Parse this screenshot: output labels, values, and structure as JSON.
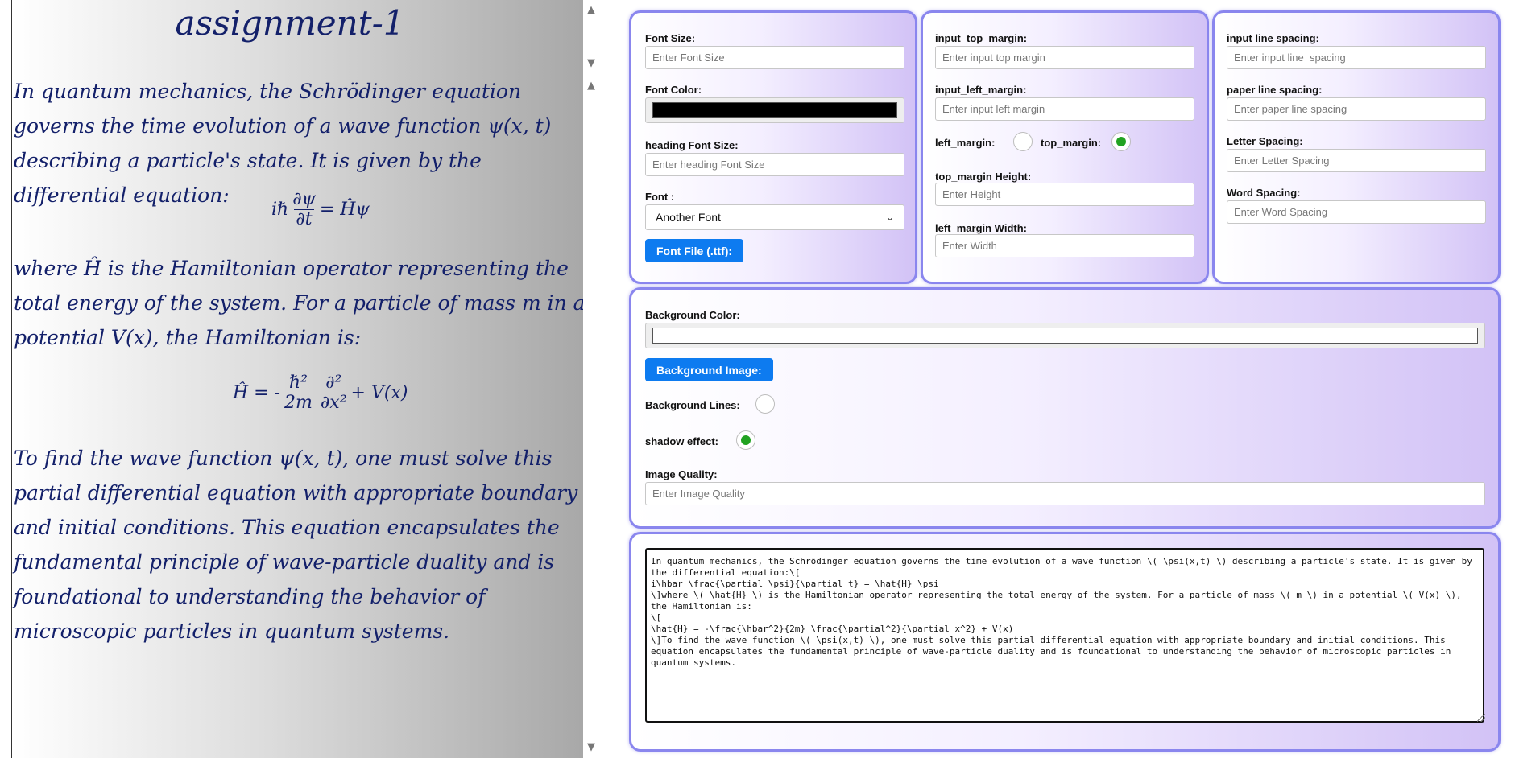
{
  "preview": {
    "title": "assignment-1",
    "para1": "In quantum mechanics, the Schrödinger equation governs the time evolution of a wave function ψ(x, t) describing a particle's state. It is given by the differential equation:",
    "eq1": {
      "lhs_prefix": "iℏ",
      "num": "∂ψ",
      "den": "∂t",
      "rhs": "= Ĥψ"
    },
    "para2": "where Ĥ is the Hamiltonian operator representing the total energy of the system. For a particle of mass m in a potential V(x), the Hamiltonian is:",
    "eq2": {
      "lhs": "Ĥ = -",
      "num1": "ℏ²",
      "den1": "2m",
      "num2": "∂²",
      "den2": "∂x²",
      "rhs": "+ V(x)"
    },
    "para3": "To find the wave function ψ(x, t), one must solve this partial differential equation with appropriate boundary and initial conditions. This equation encapsulates the fundamental principle of wave-particle duality and is foundational to understanding the behavior of microscopic particles in quantum systems.",
    "scroll_up": "▲",
    "scroll_down": "▼"
  },
  "font_panel": {
    "font_size_label": "Font Size:",
    "font_size_placeholder": "Enter Font Size",
    "font_color_label": "Font Color:",
    "font_color": "#000000",
    "heading_size_label": "heading Font Size:",
    "heading_size_placeholder": "Enter heading Font Size",
    "font_label": "Font :",
    "font_selected": "Another Font",
    "font_file_button": "Font File (.ttf):"
  },
  "margin_panel": {
    "top_margin_label": "input_top_margin:",
    "top_margin_placeholder": "Enter input top margin",
    "left_margin_label": "input_left_margin:",
    "left_margin_placeholder": "Enter input left margin",
    "left_margin_toggle_label": "left_margin:",
    "left_margin_toggle_on": false,
    "top_margin_toggle_label": "top_margin:",
    "top_margin_toggle_on": true,
    "top_height_label": "top_margin Height:",
    "top_height_placeholder": "Enter Height",
    "left_width_label": "left_margin Width:",
    "left_width_placeholder": "Enter Width"
  },
  "spacing_panel": {
    "input_line_label": "input line spacing:",
    "input_line_placeholder": "Enter input line  spacing",
    "paper_line_label": "paper line spacing:",
    "paper_line_placeholder": "Enter paper line spacing",
    "letter_label": "Letter Spacing:",
    "letter_placeholder": "Enter Letter Spacing",
    "word_label": "Word Spacing:",
    "word_placeholder": "Enter Word Spacing"
  },
  "background_panel": {
    "bg_color_label": "Background Color:",
    "bg_color": "#ffffff",
    "bg_image_button": "Background Image:",
    "bg_lines_label": "Background Lines:",
    "bg_lines_on": false,
    "shadow_label": "shadow effect:",
    "shadow_on": true,
    "quality_label": "Image Quality:",
    "quality_placeholder": "Enter Image Quality"
  },
  "editor": {
    "text": "In quantum mechanics, the Schrödinger equation governs the time evolution of a wave function \\( \\psi(x,t) \\) describing a particle's state. It is given by the differential equation:\\[\ni\\hbar \\frac{\\partial \\psi}{\\partial t} = \\hat{H} \\psi\n\\]where \\( \\hat{H} \\) is the Hamiltonian operator representing the total energy of the system. For a particle of mass \\( m \\) in a potential \\( V(x) \\), the Hamiltonian is:\n\\[\n\\hat{H} = -\\frac{\\hbar^2}{2m} \\frac{\\partial^2}{\\partial x^2} + V(x)\n\\]To find the wave function \\( \\psi(x,t) \\), one must solve this partial differential equation with appropriate boundary and initial conditions. This equation encapsulates the fundamental principle of wave-particle duality and is foundational to understanding the behavior of microscopic particles in quantum systems."
  },
  "colors": {
    "accent_button": "#0d7bf0",
    "radio_on": "#21a221",
    "panel_border": "#8a86ee",
    "handwriting_ink": "#13206a"
  }
}
